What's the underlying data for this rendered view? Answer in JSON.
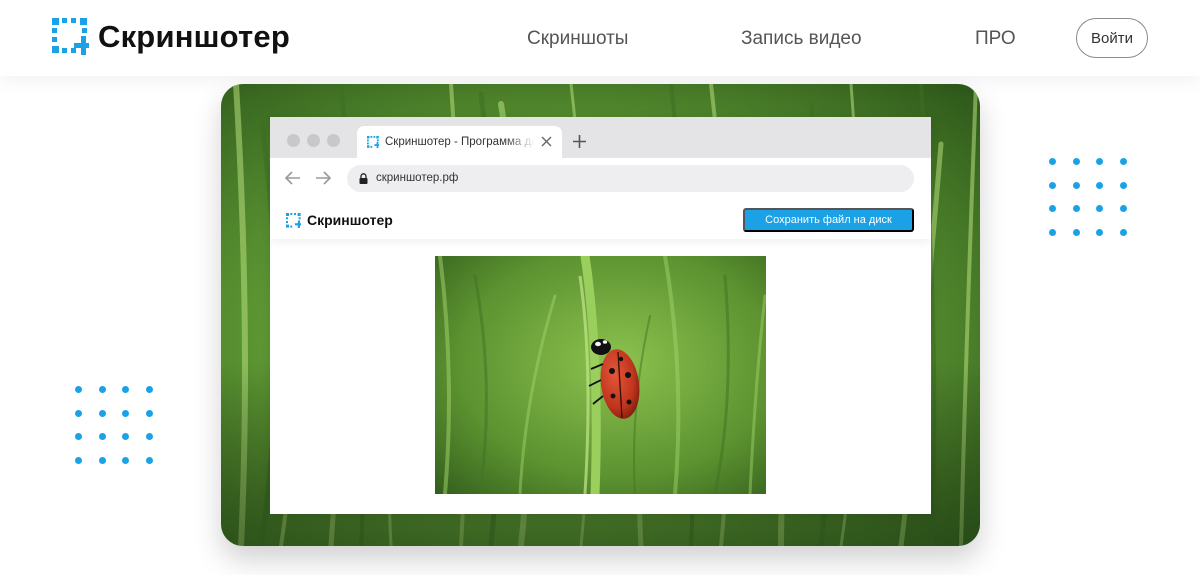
{
  "header": {
    "logo_text": "Скриншотер",
    "nav": [
      "Скриншоты",
      "Запись видео",
      "ПРО"
    ],
    "login_label": "Войти"
  },
  "browser": {
    "tab_title": "Скриншотер - Программа для скриншотов",
    "url": "скриншотер.рф",
    "app_logo_text": "Скриншотер",
    "save_button_label": "Сохранить файл на диск",
    "image_content": "ladybug-on-grass"
  },
  "colors": {
    "accent": "#1aa1e6",
    "nav_text": "#555555",
    "grass": "#5a8f2e",
    "ladybug": "#c0341d"
  },
  "icons": [
    "logo-icon",
    "close-icon",
    "plus-icon",
    "back-arrow-icon",
    "forward-arrow-icon",
    "lock-icon"
  ]
}
